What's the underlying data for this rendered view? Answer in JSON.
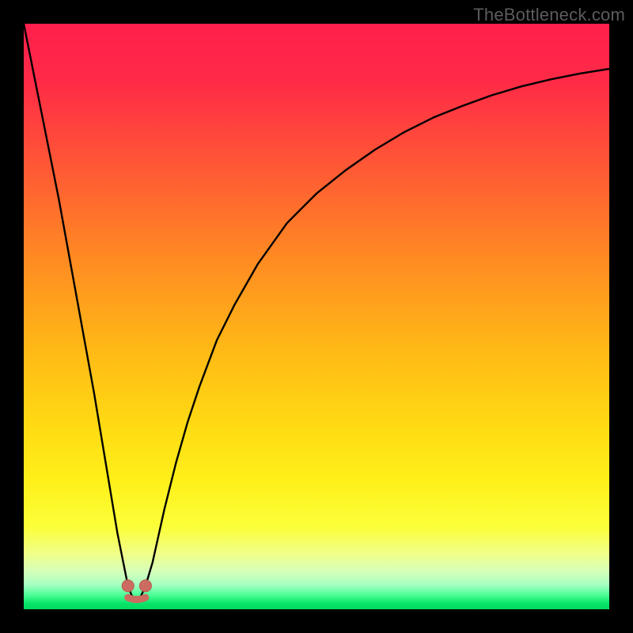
{
  "watermark": "TheBottleneck.com",
  "colors": {
    "frame": "#000000",
    "gradient_stops": [
      {
        "offset": 0.0,
        "color": "#ff1f4d"
      },
      {
        "offset": 0.1,
        "color": "#ff2b46"
      },
      {
        "offset": 0.25,
        "color": "#ff5a34"
      },
      {
        "offset": 0.4,
        "color": "#ff8a22"
      },
      {
        "offset": 0.55,
        "color": "#ffb716"
      },
      {
        "offset": 0.68,
        "color": "#ffd913"
      },
      {
        "offset": 0.78,
        "color": "#fff019"
      },
      {
        "offset": 0.86,
        "color": "#fbff3a"
      },
      {
        "offset": 0.905,
        "color": "#f0ff88"
      },
      {
        "offset": 0.935,
        "color": "#d6ffb9"
      },
      {
        "offset": 0.958,
        "color": "#a6ffc2"
      },
      {
        "offset": 0.975,
        "color": "#4fff98"
      },
      {
        "offset": 0.99,
        "color": "#07e56a"
      },
      {
        "offset": 1.0,
        "color": "#05d85f"
      }
    ],
    "curve_stroke": "#000000",
    "marker_fill": "#cc6b5f",
    "marker_stroke": "#b95a4f"
  },
  "chart_data": {
    "type": "line",
    "title": "",
    "xlabel": "",
    "ylabel": "",
    "xlim": [
      0,
      100
    ],
    "ylim": [
      0,
      100
    ],
    "grid": false,
    "legend": false,
    "notes": "No axis tick labels, values, title, or legend are rendered in the image. Curve shape is a steep V with minimum near x≈18–20 and a slowly rising right branch. Values below estimated from pixel positions.",
    "series": [
      {
        "name": "bottleneck-curve",
        "x": [
          0,
          2,
          4,
          6,
          8,
          10,
          12,
          14,
          15,
          16,
          17,
          17.8,
          18.5,
          19.3,
          20,
          20.8,
          22,
          24,
          26,
          28,
          30,
          33,
          36,
          40,
          45,
          50,
          55,
          60,
          65,
          70,
          75,
          80,
          85,
          90,
          95,
          100
        ],
        "y": [
          100,
          90,
          80,
          70,
          59,
          48,
          37,
          25,
          19,
          13,
          8,
          4.0,
          2.2,
          2.0,
          2.2,
          4.0,
          8,
          17,
          25,
          32,
          38,
          46,
          52,
          59,
          66,
          71,
          75,
          78.5,
          81.5,
          84,
          86,
          87.8,
          89.3,
          90.5,
          91.5,
          92.3
        ]
      }
    ],
    "markers": [
      {
        "x": 17.8,
        "y": 4.0
      },
      {
        "x": 20.8,
        "y": 4.0
      }
    ],
    "valley_connector": {
      "from_x": 17.8,
      "to_x": 20.8,
      "y": 2.0
    }
  }
}
